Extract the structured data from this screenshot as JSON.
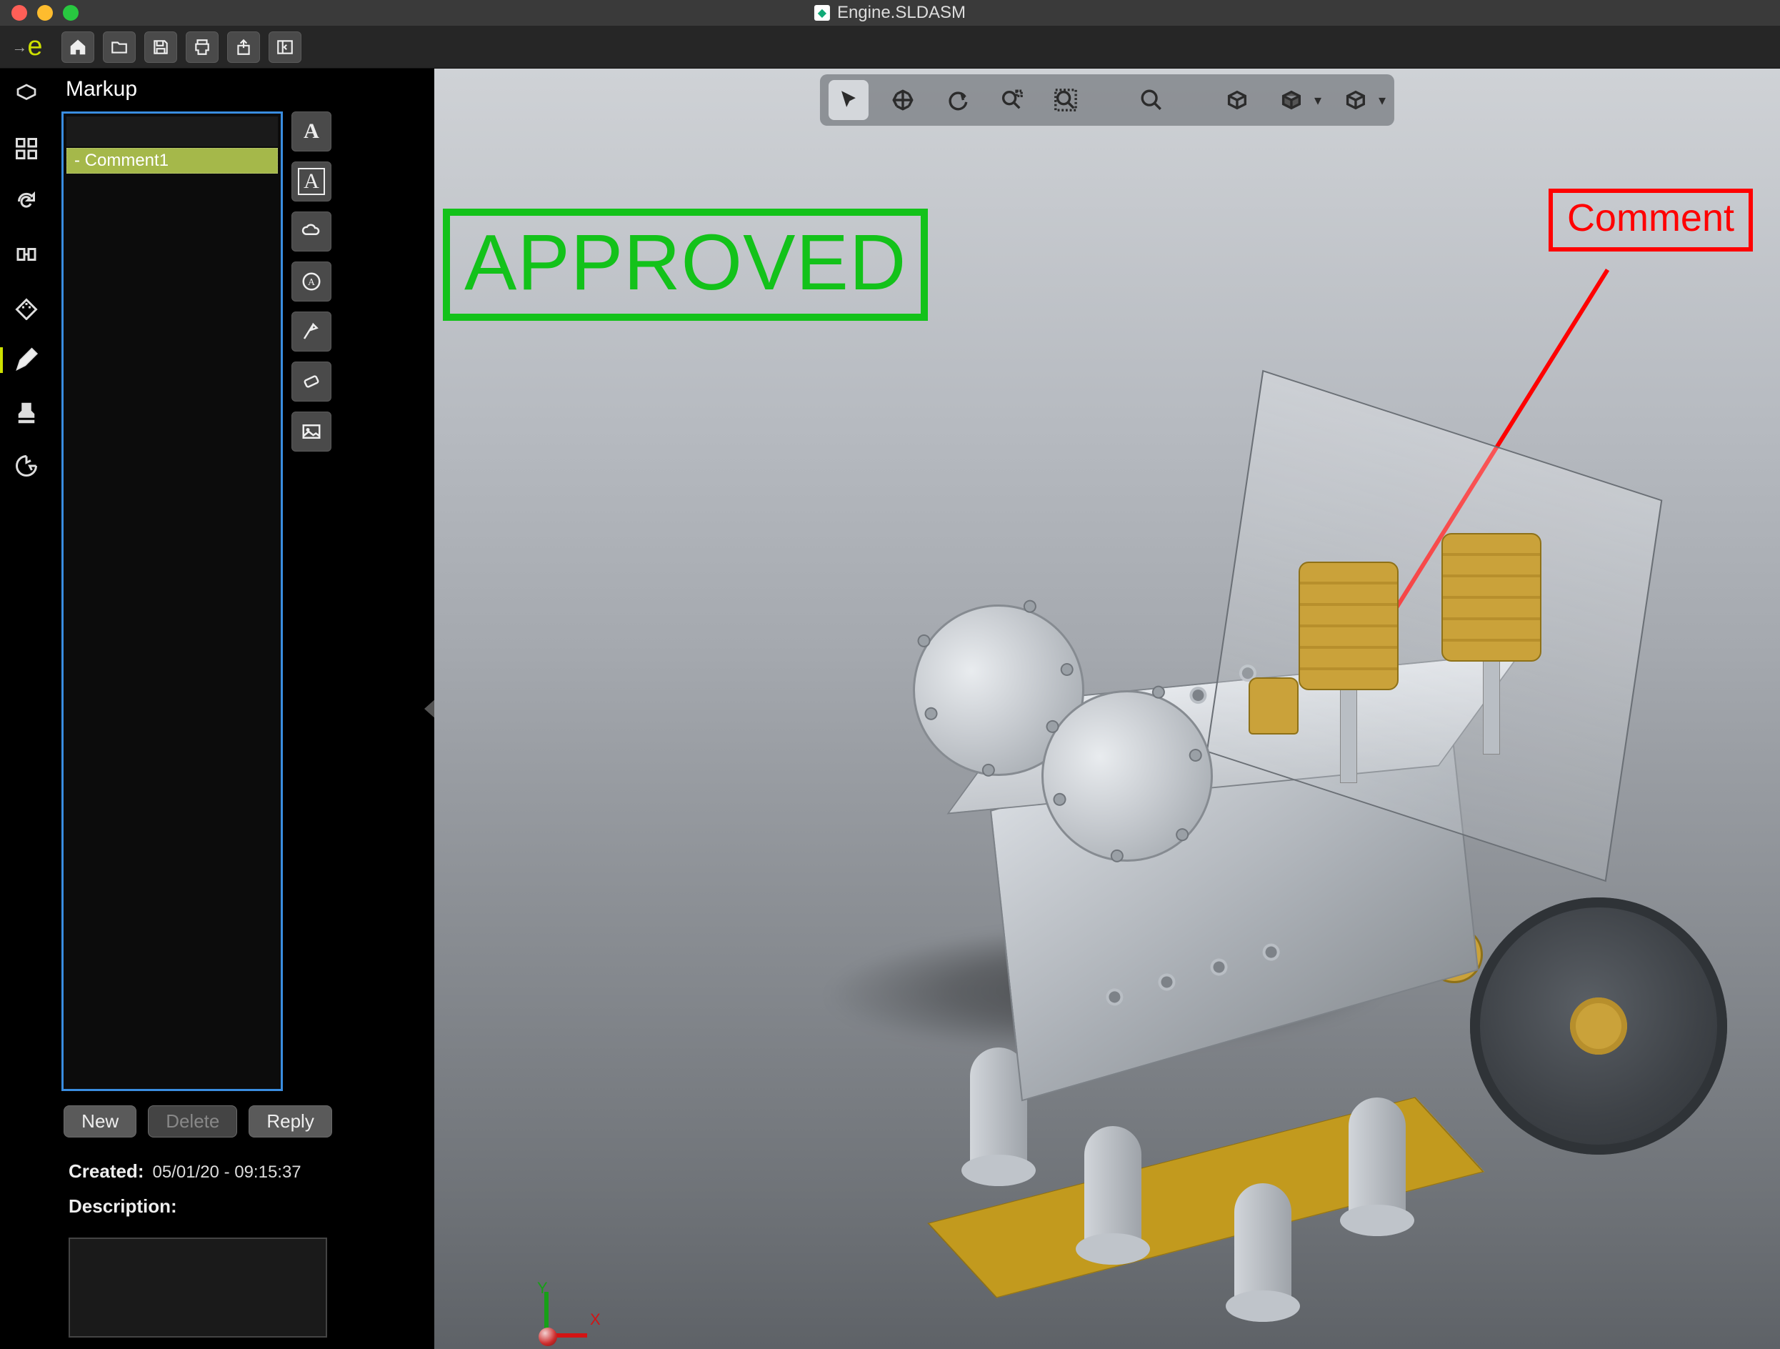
{
  "window": {
    "title": "Engine.SLDASM"
  },
  "logo": {
    "text": "e",
    "prefix": "→"
  },
  "toolbar_top": {
    "buttons": [
      "home",
      "open",
      "save",
      "print",
      "share",
      "panel-toggle"
    ]
  },
  "rail": {
    "items": [
      {
        "name": "model-tree-icon"
      },
      {
        "name": "views-grid-icon"
      },
      {
        "name": "refresh-icon"
      },
      {
        "name": "section-icon"
      },
      {
        "name": "measure-icon"
      },
      {
        "name": "markup-icon",
        "active": true
      },
      {
        "name": "stamp-icon"
      },
      {
        "name": "export-icon"
      }
    ]
  },
  "panel": {
    "title": "Markup",
    "tree": {
      "items": [
        {
          "label": "- Comment1",
          "selected": true
        }
      ]
    },
    "tools": [
      "text-plain",
      "text-box",
      "cloud",
      "circled-text",
      "pointer-tool",
      "eraser",
      "image-insert"
    ],
    "actions": {
      "new_label": "New",
      "delete_label": "Delete",
      "reply_label": "Reply"
    },
    "meta": {
      "created_label": "Created:",
      "created_value": "05/01/20 - 09:15:37",
      "description_label": "Description:"
    }
  },
  "viewport": {
    "stamp_text": "APPROVED",
    "callout_text": "Comment",
    "triad": {
      "x": "X",
      "y": "Y"
    },
    "toolbar": [
      "select",
      "pan",
      "orbit",
      "zoom-window",
      "zoom-fit",
      "zoom",
      "shade-box",
      "shade-style",
      "render-style"
    ]
  }
}
